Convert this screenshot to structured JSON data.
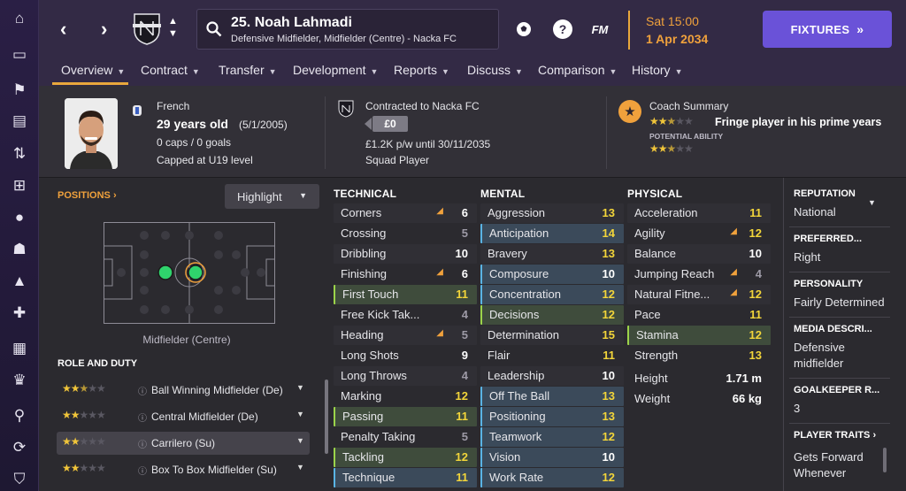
{
  "nav": {
    "back": "‹",
    "forward": "›"
  },
  "player": {
    "name": "25. Noah Lahmadi",
    "positions": "Defensive Midfielder, Midfielder (Centre) - Nacka FC"
  },
  "top_icons": {
    "fm": "FM",
    "help": "?"
  },
  "date": {
    "day": "Sat 15:00",
    "date": "1 Apr 2034"
  },
  "fixtures_label": "FIXTURES",
  "tabs": [
    "Overview",
    "Contract",
    "Transfer",
    "Development",
    "Reports",
    "Discuss",
    "Comparison",
    "History"
  ],
  "bio": {
    "nationality": "French",
    "age": "29 years old",
    "dob": "(5/1/2005)",
    "caps": "0 caps / 0 goals",
    "capped": "Capped at U19 level"
  },
  "contract": {
    "title": "Contracted to Nacka FC",
    "fee": "£0",
    "wage": "£1.2K p/w until 30/11/2035",
    "status": "Squad Player"
  },
  "coach": {
    "title": "Coach Summary",
    "summary": "Fringe player in his prime years",
    "potential_label": "POTENTIAL ABILITY",
    "current_stars": 2.5,
    "potential_stars": 2.5
  },
  "positions": {
    "title": "POSITIONS",
    "highlight": "Highlight",
    "label": "Midfielder (Centre)"
  },
  "roles": {
    "title": "ROLE AND DUTY",
    "items": [
      {
        "name": "Ball Winning Midfielder (De)",
        "stars": 2.5
      },
      {
        "name": "Central Midfielder (De)",
        "stars": 2
      },
      {
        "name": "Carrilero (Su)",
        "stars": 2
      },
      {
        "name": "Box To Box Midfielder (Su)",
        "stars": 2
      }
    ]
  },
  "technical": {
    "title": "TECHNICAL",
    "items": [
      {
        "name": "Corners",
        "value": "6",
        "arrow": true
      },
      {
        "name": "Crossing",
        "value": "5"
      },
      {
        "name": "Dribbling",
        "value": "10"
      },
      {
        "name": "Finishing",
        "value": "6",
        "arrow": true
      },
      {
        "name": "First Touch",
        "value": "11",
        "hl": "g"
      },
      {
        "name": "Free Kick Tak...",
        "value": "4"
      },
      {
        "name": "Heading",
        "value": "5",
        "arrow": true
      },
      {
        "name": "Long Shots",
        "value": "9"
      },
      {
        "name": "Long Throws",
        "value": "4"
      },
      {
        "name": "Marking",
        "value": "12"
      },
      {
        "name": "Passing",
        "value": "11",
        "hl": "g"
      },
      {
        "name": "Penalty Taking",
        "value": "5"
      },
      {
        "name": "Tackling",
        "value": "12",
        "hl": "g"
      },
      {
        "name": "Technique",
        "value": "11",
        "hl": "b"
      }
    ]
  },
  "mental": {
    "title": "MENTAL",
    "items": [
      {
        "name": "Aggression",
        "value": "13"
      },
      {
        "name": "Anticipation",
        "value": "14",
        "hl": "b"
      },
      {
        "name": "Bravery",
        "value": "13"
      },
      {
        "name": "Composure",
        "value": "10",
        "hl": "b"
      },
      {
        "name": "Concentration",
        "value": "12",
        "hl": "b"
      },
      {
        "name": "Decisions",
        "value": "12",
        "hl": "g"
      },
      {
        "name": "Determination",
        "value": "15"
      },
      {
        "name": "Flair",
        "value": "11"
      },
      {
        "name": "Leadership",
        "value": "10"
      },
      {
        "name": "Off The Ball",
        "value": "13",
        "hl": "b"
      },
      {
        "name": "Positioning",
        "value": "13",
        "hl": "b"
      },
      {
        "name": "Teamwork",
        "value": "12",
        "hl": "b"
      },
      {
        "name": "Vision",
        "value": "10",
        "hl": "b"
      },
      {
        "name": "Work Rate",
        "value": "12",
        "hl": "b"
      }
    ]
  },
  "physical": {
    "title": "PHYSICAL",
    "items": [
      {
        "name": "Acceleration",
        "value": "11"
      },
      {
        "name": "Agility",
        "value": "12",
        "arrow": true
      },
      {
        "name": "Balance",
        "value": "10"
      },
      {
        "name": "Jumping Reach",
        "value": "4",
        "arrow": true
      },
      {
        "name": "Natural Fitne...",
        "value": "12",
        "arrow": true
      },
      {
        "name": "Pace",
        "value": "11"
      },
      {
        "name": "Stamina",
        "value": "12",
        "hl": "g"
      },
      {
        "name": "Strength",
        "value": "13"
      }
    ],
    "height_label": "Height",
    "height": "1.71 m",
    "weight_label": "Weight",
    "weight": "66 kg"
  },
  "side": {
    "reputation_label": "REPUTATION",
    "reputation": "National",
    "foot_label": "PREFERRED...",
    "foot": "Right",
    "personality_label": "PERSONALITY",
    "personality": "Fairly Determined",
    "media_label": "MEDIA DESCRI...",
    "media_1": "Defensive",
    "media_2": "midfielder",
    "gk_label": "GOALKEEPER R...",
    "gk": "3",
    "traits_label": "PLAYER TRAITS",
    "trait_1": "Gets Forward",
    "trait_2": "Whenever"
  },
  "colors": {
    "accent": "#f0a13c",
    "fixtures": "#6a52d8",
    "value_high": "#f2d53a",
    "key_green": "#9cd44a",
    "key_blue": "#5ab4e5"
  }
}
